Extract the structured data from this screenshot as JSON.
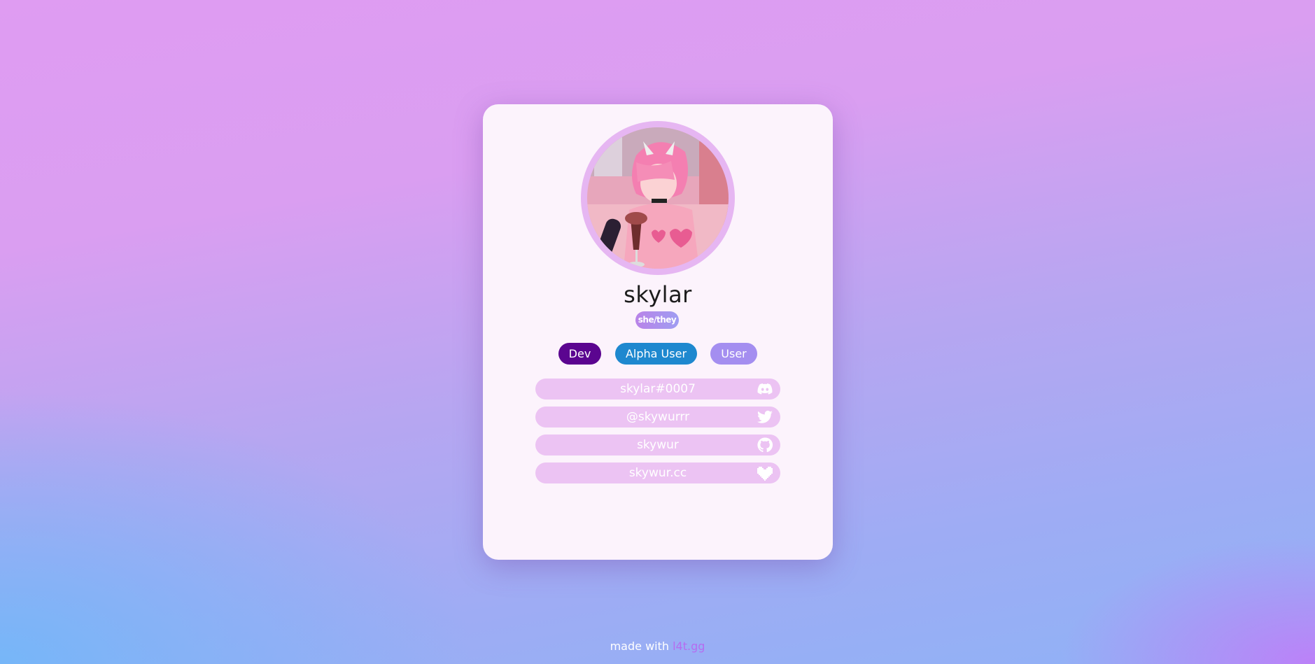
{
  "profile": {
    "name": "skylar",
    "pronouns": "she/they",
    "avatar_icon": "anime-avatar-image"
  },
  "badges": [
    {
      "label": "Dev",
      "color": "#5b0590"
    },
    {
      "label": "Alpha User",
      "color": "#1e88cf"
    },
    {
      "label": "User",
      "color": "#a48ef0"
    }
  ],
  "links": [
    {
      "label": "skylar#0007",
      "icon": "discord-icon"
    },
    {
      "label": "@skywurrr",
      "icon": "twitter-icon"
    },
    {
      "label": "skywur",
      "icon": "github-icon"
    },
    {
      "label": "skywur.cc",
      "icon": "heart-icon"
    }
  ],
  "footer": {
    "text": "made with",
    "link_label": "l4t.gg"
  },
  "colors": {
    "card_background": "#fcf3fc",
    "link_background": "#ecc3f3",
    "footer_link": "#b56cf0"
  }
}
